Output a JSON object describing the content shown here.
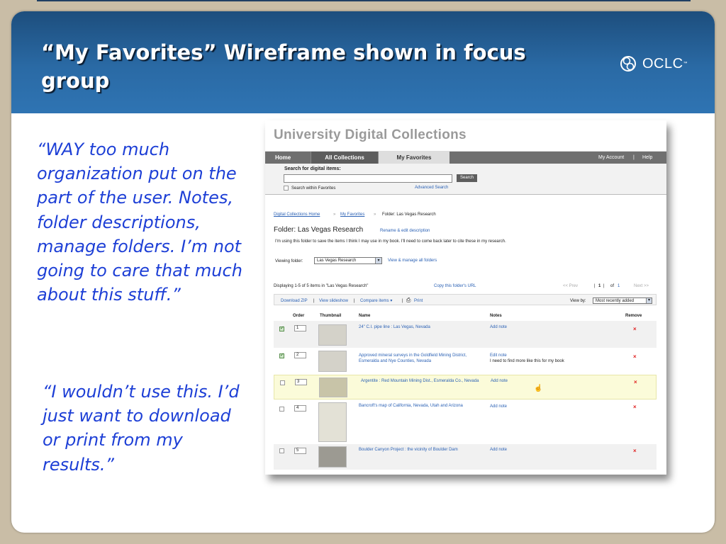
{
  "slide": {
    "title": "“My Favorites” Wireframe shown in focus group",
    "logo_text": "OCLC",
    "logo_mark": "™",
    "quote1": "“WAY too much organization put on the part of the user. Notes, folder descriptions, manage folders. I’m not going to care that much about this stuff.”",
    "quote2": "“I wouldn’t use this. I’d just want to download or print from my results.”"
  },
  "wireframe": {
    "site_title": "University Digital Collections",
    "nav": {
      "home": "Home",
      "all": "All Collections",
      "favorites": "My Favorites",
      "account": "My Account",
      "sep": "|",
      "help": "Help"
    },
    "search": {
      "label": "Search for digital items:",
      "value": "",
      "button": "Search",
      "within": "Search within Favorites",
      "advanced": "Advanced Search"
    },
    "breadcrumb": {
      "home": "Digital Collections Home",
      "sep1": "»",
      "favorites": "My Favorites",
      "sep2": "»",
      "current": "Folder: Las Vegas Research"
    },
    "folder": {
      "label": "Folder:",
      "name": "Las Vegas Research",
      "rename": "Rename & edit description",
      "description": "I'm using this folder to save the items I think I may use in my book. I'll need to come back later to cite these in my research.",
      "viewing_label": "Viewing folder:",
      "viewing_value": "Las Vegas Research",
      "manage": "View & manage all folders"
    },
    "results": {
      "displaying": "Displaying 1-5 of 5 items in \"Las Vegas Research\"",
      "copy_url": "Copy this folder's URL",
      "prev": "<< Prev",
      "page_sep1": "|",
      "page": "1",
      "page_sep2": "|",
      "of": "of",
      "total_pages": "1",
      "next": "Next >>"
    },
    "toolbar": {
      "download": "Download ZIP",
      "sep1": "|",
      "slideshow": "View slideshow",
      "sep2": "|",
      "compare": "Compare items ▾",
      "sep3": "|",
      "print_icon": "printer-icon",
      "print": "Print",
      "view_by": "View by:",
      "view_by_value": "Most recently added"
    },
    "columns": {
      "order": "Order",
      "thumbnail": "Thumbnail",
      "name": "Name",
      "notes": "Notes",
      "remove": "Remove"
    },
    "rows": [
      {
        "checked": true,
        "order": "1",
        "name": "24\" C.I. pipe line : Las Vegas, Nevada",
        "note_link": "Add note",
        "note_text": "",
        "remove": "×"
      },
      {
        "checked": true,
        "order": "2",
        "name": "Approved mineral surveys in the Goldfield Mining District, Esmeralda and Nye Counties, Nevada",
        "note_link": "Edit note",
        "note_text": "I need to find more like this for my book",
        "remove": "×"
      },
      {
        "checked": false,
        "order": "3",
        "name": "Argentite : Red Mountain Mining Dist., Esmeralda Co., Nevada",
        "note_link": "Add note",
        "note_text": "",
        "remove": "×"
      },
      {
        "checked": false,
        "order": "4",
        "name": "Bancroft's map of California, Nevada, Utah and Arizona",
        "note_link": "Add note",
        "note_text": "",
        "remove": "×"
      },
      {
        "checked": false,
        "order": "5",
        "name": "Boulder Canyon Project : the vicinity of Boulder Dam",
        "note_link": "Add note",
        "note_text": "",
        "remove": "×"
      }
    ]
  },
  "colors": {
    "banner": "#2a6aa5",
    "quote": "#1d3fd6",
    "link": "#2c62b5",
    "remove": "#e02020",
    "highlight_row": "#fbfbd9"
  }
}
